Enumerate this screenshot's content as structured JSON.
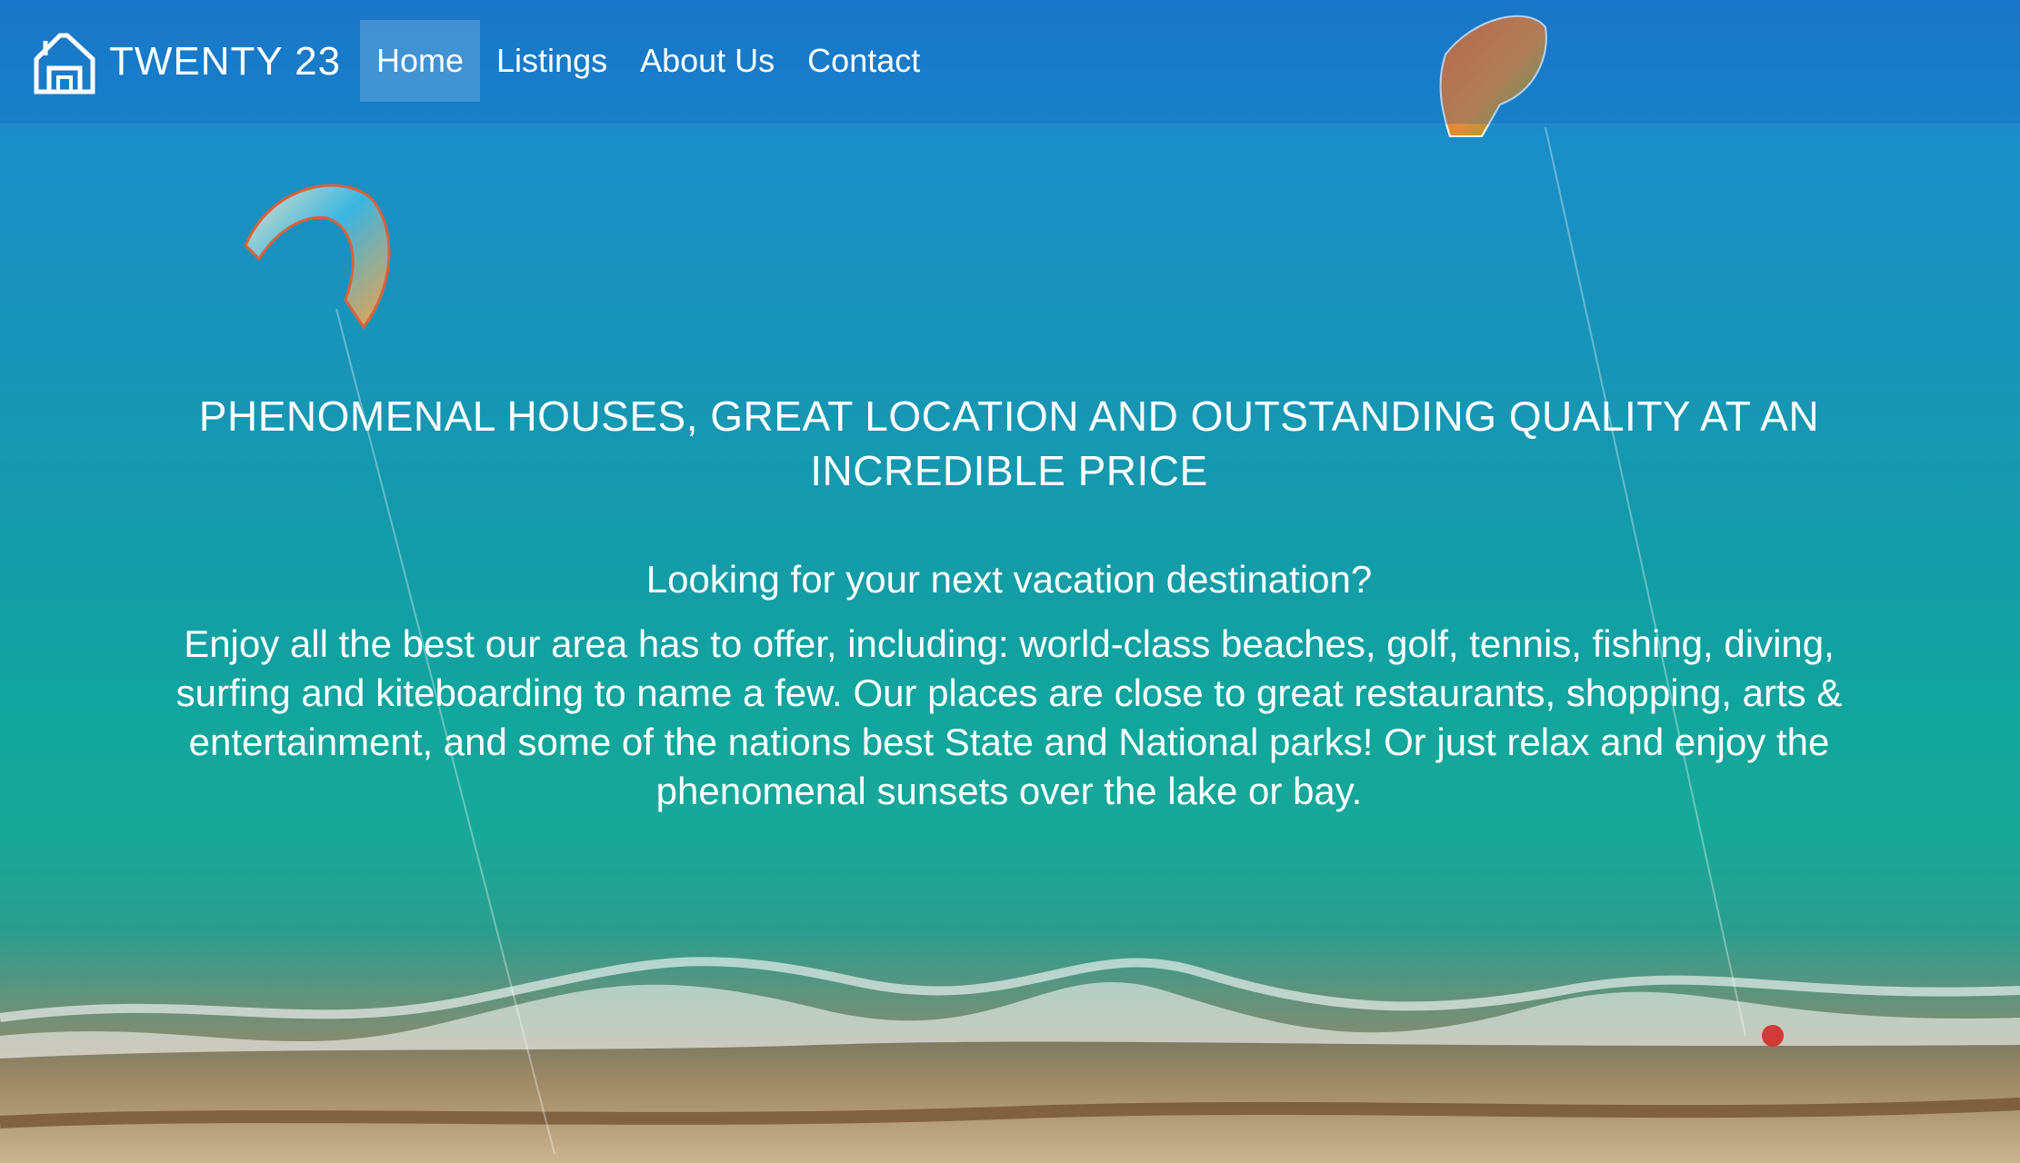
{
  "brand": {
    "name": "TWENTY 23",
    "logo_icon": "house-outline-icon"
  },
  "nav": {
    "items": [
      {
        "label": "Home",
        "active": true
      },
      {
        "label": "Listings",
        "active": false
      },
      {
        "label": "About Us",
        "active": false
      },
      {
        "label": "Contact",
        "active": false
      }
    ]
  },
  "hero": {
    "headline": "PHENOMENAL HOUSES, GREAT LOCATION AND OUTSTANDING QUALITY AT AN INCREDIBLE PRICE",
    "subhead": "Looking for your next vacation destination?",
    "body": "Enjoy all the best our area has to offer, including: world-class beaches, golf, tennis, fishing, diving, surfing and kiteboarding to name a few.  Our places are close to great restaurants, shopping, arts & entertainment, and some of the nations best State and National parks!  Or just relax and enjoy the phenomenal sunsets over the lake or bay."
  },
  "colors": {
    "text": "#ffffff",
    "ocean": "#139ca8",
    "sand": "#c8b08a"
  }
}
